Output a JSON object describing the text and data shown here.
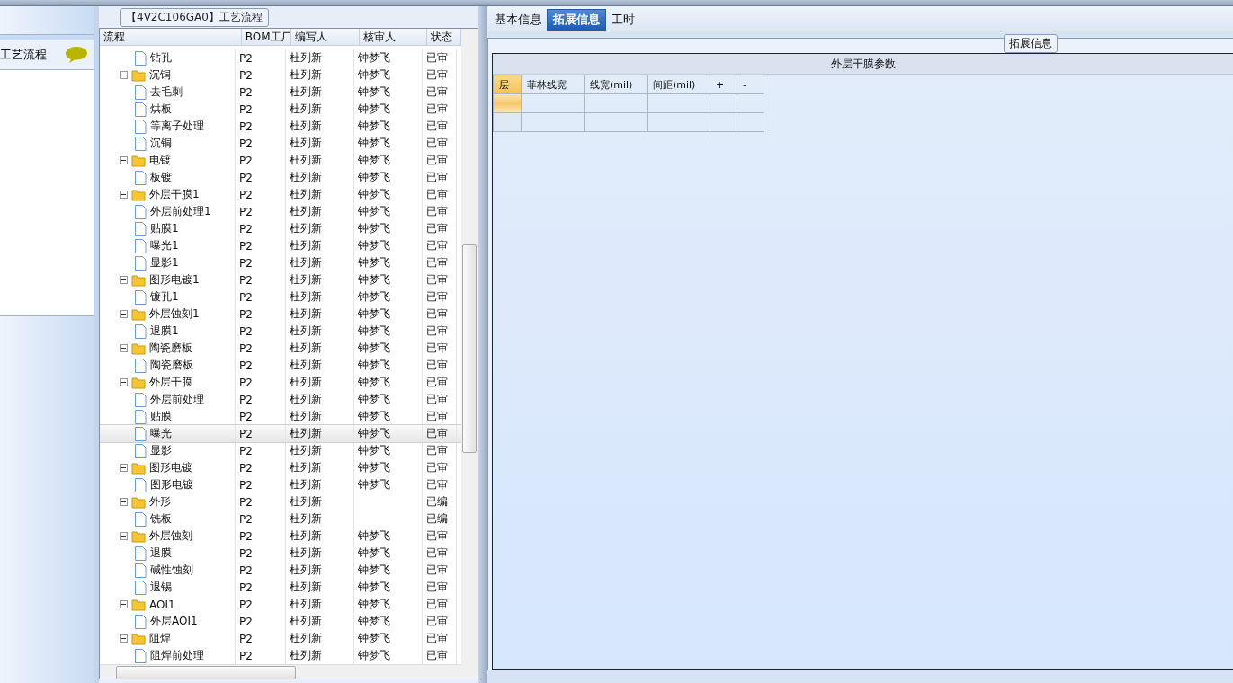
{
  "left_panel": {
    "title": "工艺流程"
  },
  "flow_panel": {
    "title": "【4V2C106GA0】工艺流程",
    "columns": [
      "流程",
      "BOM工厂",
      "编写人",
      "核审人",
      "状态"
    ],
    "tree": [
      {
        "children": [
          {
            "name": "钻孔",
            "factory": "P2",
            "writer": "杜列新",
            "reviewer": "钟梦飞",
            "status": "已审",
            "selected": false
          }
        ]
      },
      {
        "name": "沉铜",
        "factory": "P2",
        "writer": "杜列新",
        "reviewer": "钟梦飞",
        "status": "已审",
        "selected": false,
        "expanded": true,
        "children": [
          {
            "name": "去毛刺",
            "factory": "P2",
            "writer": "杜列新",
            "reviewer": "钟梦飞",
            "status": "已审",
            "selected": false
          },
          {
            "name": "烘板",
            "factory": "P2",
            "writer": "杜列新",
            "reviewer": "钟梦飞",
            "status": "已审",
            "selected": false
          },
          {
            "name": "等离子处理",
            "factory": "P2",
            "writer": "杜列新",
            "reviewer": "钟梦飞",
            "status": "已审",
            "selected": false
          },
          {
            "name": "沉铜",
            "factory": "P2",
            "writer": "杜列新",
            "reviewer": "钟梦飞",
            "status": "已审",
            "selected": false
          }
        ]
      },
      {
        "name": "电镀",
        "factory": "P2",
        "writer": "杜列新",
        "reviewer": "钟梦飞",
        "status": "已审",
        "selected": false,
        "expanded": true,
        "children": [
          {
            "name": "板镀",
            "factory": "P2",
            "writer": "杜列新",
            "reviewer": "钟梦飞",
            "status": "已审",
            "selected": false
          }
        ]
      },
      {
        "name": "外层干膜1",
        "factory": "P2",
        "writer": "杜列新",
        "reviewer": "钟梦飞",
        "status": "已审",
        "selected": false,
        "expanded": true,
        "children": [
          {
            "name": "外层前处理1",
            "factory": "P2",
            "writer": "杜列新",
            "reviewer": "钟梦飞",
            "status": "已审",
            "selected": false
          },
          {
            "name": "贴膜1",
            "factory": "P2",
            "writer": "杜列新",
            "reviewer": "钟梦飞",
            "status": "已审",
            "selected": false
          },
          {
            "name": "曝光1",
            "factory": "P2",
            "writer": "杜列新",
            "reviewer": "钟梦飞",
            "status": "已审",
            "selected": false
          },
          {
            "name": "显影1",
            "factory": "P2",
            "writer": "杜列新",
            "reviewer": "钟梦飞",
            "status": "已审",
            "selected": false
          }
        ]
      },
      {
        "name": "图形电镀1",
        "factory": "P2",
        "writer": "杜列新",
        "reviewer": "钟梦飞",
        "status": "已审",
        "selected": false,
        "expanded": true,
        "children": [
          {
            "name": "镀孔1",
            "factory": "P2",
            "writer": "杜列新",
            "reviewer": "钟梦飞",
            "status": "已审",
            "selected": false
          }
        ]
      },
      {
        "name": "外层蚀刻1",
        "factory": "P2",
        "writer": "杜列新",
        "reviewer": "钟梦飞",
        "status": "已审",
        "selected": false,
        "expanded": true,
        "children": [
          {
            "name": "退膜1",
            "factory": "P2",
            "writer": "杜列新",
            "reviewer": "钟梦飞",
            "status": "已审",
            "selected": false
          }
        ]
      },
      {
        "name": "陶瓷磨板",
        "factory": "P2",
        "writer": "杜列新",
        "reviewer": "钟梦飞",
        "status": "已审",
        "selected": false,
        "expanded": true,
        "children": [
          {
            "name": "陶瓷磨板",
            "factory": "P2",
            "writer": "杜列新",
            "reviewer": "钟梦飞",
            "status": "已审",
            "selected": false
          }
        ]
      },
      {
        "name": "外层干膜",
        "factory": "P2",
        "writer": "杜列新",
        "reviewer": "钟梦飞",
        "status": "已审",
        "selected": false,
        "expanded": true,
        "children": [
          {
            "name": "外层前处理",
            "factory": "P2",
            "writer": "杜列新",
            "reviewer": "钟梦飞",
            "status": "已审",
            "selected": false
          },
          {
            "name": "贴膜",
            "factory": "P2",
            "writer": "杜列新",
            "reviewer": "钟梦飞",
            "status": "已审",
            "selected": false
          },
          {
            "name": "曝光",
            "factory": "P2",
            "writer": "杜列新",
            "reviewer": "钟梦飞",
            "status": "已审",
            "selected": true
          },
          {
            "name": "显影",
            "factory": "P2",
            "writer": "杜列新",
            "reviewer": "钟梦飞",
            "status": "已审",
            "selected": false
          }
        ]
      },
      {
        "name": "图形电镀",
        "factory": "P2",
        "writer": "杜列新",
        "reviewer": "钟梦飞",
        "status": "已审",
        "selected": false,
        "expanded": true,
        "children": [
          {
            "name": "图形电镀",
            "factory": "P2",
            "writer": "杜列新",
            "reviewer": "钟梦飞",
            "status": "已审",
            "selected": false
          }
        ]
      },
      {
        "name": "外形",
        "factory": "P2",
        "writer": "杜列新",
        "status": "已编",
        "selected": false,
        "expanded": true,
        "children": [
          {
            "name": "铣板",
            "factory": "P2",
            "writer": "杜列新",
            "status": "已编",
            "selected": false
          }
        ]
      },
      {
        "name": "外层蚀刻",
        "factory": "P2",
        "writer": "杜列新",
        "reviewer": "钟梦飞",
        "status": "已审",
        "selected": false,
        "expanded": true,
        "children": [
          {
            "name": "退膜",
            "factory": "P2",
            "writer": "杜列新",
            "reviewer": "钟梦飞",
            "status": "已审",
            "selected": false
          },
          {
            "name": "碱性蚀刻",
            "factory": "P2",
            "writer": "杜列新",
            "reviewer": "钟梦飞",
            "status": "已审",
            "selected": false
          },
          {
            "name": "退锡",
            "factory": "P2",
            "writer": "杜列新",
            "reviewer": "钟梦飞",
            "status": "已审",
            "selected": false
          }
        ]
      },
      {
        "name": "AOI1",
        "factory": "P2",
        "writer": "杜列新",
        "reviewer": "钟梦飞",
        "status": "已审",
        "selected": false,
        "expanded": true,
        "children": [
          {
            "name": "外层AOI1",
            "factory": "P2",
            "writer": "杜列新",
            "reviewer": "钟梦飞",
            "status": "已审",
            "selected": false
          }
        ]
      },
      {
        "name": "阻焊",
        "factory": "P2",
        "writer": "杜列新",
        "reviewer": "钟梦飞",
        "status": "已审",
        "selected": false,
        "expanded": true,
        "children": [
          {
            "name": "阻焊前处理",
            "factory": "P2",
            "writer": "杜列新",
            "reviewer": "钟梦飞",
            "status": "已审",
            "selected": false
          }
        ]
      }
    ]
  },
  "detail_panel": {
    "tabs": [
      {
        "label": "基本信息",
        "selected": false
      },
      {
        "label": "拓展信息",
        "selected": true
      },
      {
        "label": "工时",
        "selected": false
      }
    ],
    "group_title": "拓展信息",
    "grid_title": "外层干膜参数",
    "grid_columns": [
      "层",
      "菲林线宽",
      "线宽(mil)",
      "间距(mil)",
      "+",
      "-"
    ],
    "grid_rows": [
      {
        "selected": true
      },
      {
        "selected": false
      }
    ]
  }
}
